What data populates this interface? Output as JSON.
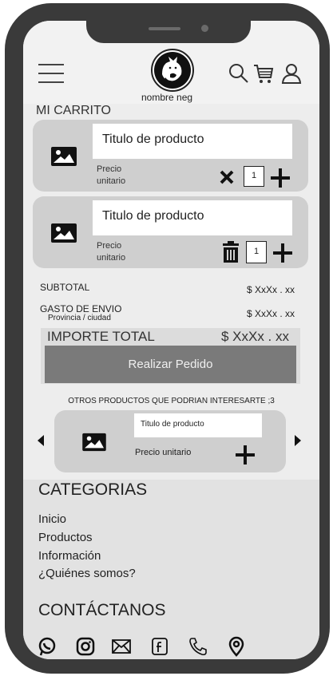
{
  "header": {
    "brand_name": "nombre neg",
    "icons": [
      "hamburger-menu-icon",
      "search-icon",
      "cart-icon",
      "user-icon"
    ]
  },
  "cart": {
    "title": "MI CARRITO",
    "items": [
      {
        "title": "Titulo de producto",
        "unit_label": "Precio unitario",
        "quantity": "1",
        "action_icon": "close-icon"
      },
      {
        "title": "Titulo de producto",
        "unit_label": "Precio unitario",
        "quantity": "1",
        "action_icon": "trash-icon"
      }
    ]
  },
  "summary": {
    "subtotal_label": "SUBTOTAL",
    "subtotal_value": "$ XxXx . xx",
    "shipping_label": "GASTO DE ENVIO",
    "shipping_sub": "Provincia / ciudad",
    "shipping_value": "$ XxXx . xx",
    "total_label": "IMPORTE TOTAL",
    "total_value": "$ XxXx . xx",
    "order_button": "Realizar Pedido"
  },
  "recommendations": {
    "title": "OTROS PRODUCTOS QUE PODRIAN INTERESARTE ;3",
    "item": {
      "title": "Titulo de producto",
      "price_label": "Precio unitario"
    }
  },
  "footer": {
    "categories_title": "CATEGORIAS",
    "links": [
      "Inicio",
      "Productos",
      "Información",
      "¿Quiénes somos?"
    ],
    "contact_title": "CONTÁCTANOS",
    "social_icons": [
      "whatsapp-icon",
      "instagram-icon",
      "mail-icon",
      "facebook-icon",
      "phone-icon",
      "location-icon"
    ]
  }
}
